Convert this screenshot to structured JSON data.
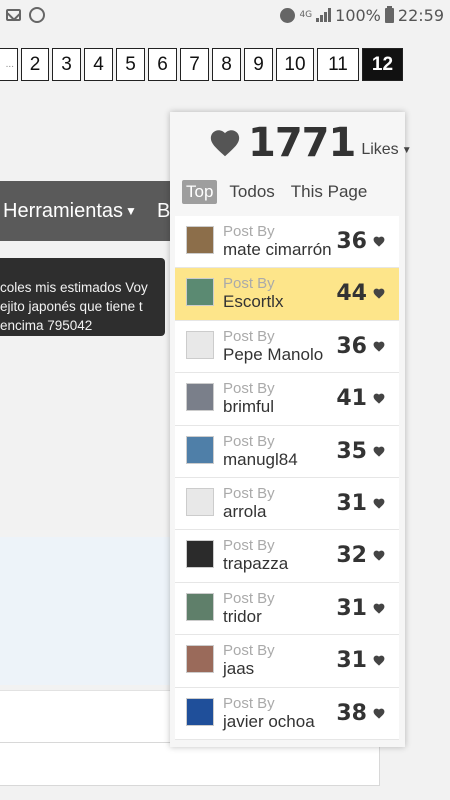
{
  "status_bar": {
    "battery": "100%",
    "time": "22:59",
    "network": "4G",
    "icons": [
      "mail-icon",
      "whatsapp-icon",
      "alarm-icon",
      "signal-icon",
      "battery-icon"
    ]
  },
  "pagination": {
    "pages": [
      "2",
      "3",
      "4",
      "5",
      "6",
      "7",
      "8",
      "9",
      "10",
      "11",
      "12"
    ],
    "current": "12",
    "dots": "..."
  },
  "toolbar": {
    "menu_label": "Herramientas",
    "next_label": "B"
  },
  "tooltip": {
    "lines": [
      "coles mis estimados Voy",
      "ejito japonés que tiene t",
      "encima 795042"
    ]
  },
  "likes": {
    "count": "1771",
    "label": "Likes",
    "tabs": [
      "Top",
      "Todos",
      "This Page"
    ],
    "active_tab": "Top",
    "post_by_label": "Post By",
    "entries": [
      {
        "user": "mate cimarrón",
        "count": "36",
        "avatar_color": "#8c6e4a",
        "highlight": false
      },
      {
        "user": "Escortlx",
        "count": "44",
        "avatar_color": "#5b8a72",
        "highlight": true
      },
      {
        "user": "Pepe Manolo",
        "count": "36",
        "avatar_color": "#e8e8e8",
        "highlight": false
      },
      {
        "user": "brimful",
        "count": "41",
        "avatar_color": "#7a7f8a",
        "highlight": false
      },
      {
        "user": "manugl84",
        "count": "35",
        "avatar_color": "#4f7fa8",
        "highlight": false
      },
      {
        "user": "arrola",
        "count": "31",
        "avatar_color": "#e8e8e8",
        "highlight": false
      },
      {
        "user": "trapazza",
        "count": "32",
        "avatar_color": "#2b2b2b",
        "highlight": false
      },
      {
        "user": "tridor",
        "count": "31",
        "avatar_color": "#5f7f6a",
        "highlight": false
      },
      {
        "user": "jaas",
        "count": "31",
        "avatar_color": "#9a6a5a",
        "highlight": false
      },
      {
        "user": "javier ochoa",
        "count": "38",
        "avatar_color": "#1f4f9a",
        "highlight": false
      }
    ]
  },
  "colors": {
    "highlight": "#fde58a",
    "heart": "#444444",
    "dark_bar": "#5a5a5a"
  }
}
